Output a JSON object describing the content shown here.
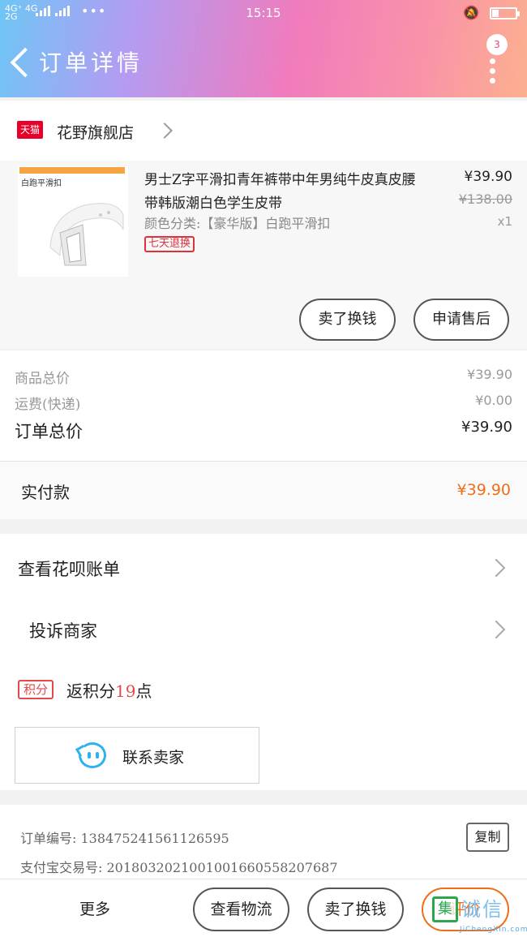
{
  "status_bar": {
    "network": "4G⁺ 4G\n2G",
    "signal2": "2G",
    "dots": "•••",
    "time": "15:15"
  },
  "header": {
    "title": "订单详情",
    "badge_count": "3"
  },
  "shop": {
    "logo_text": "天猫",
    "name": "花野旗舰店"
  },
  "product": {
    "thumb_tag": "白跑平滑扣",
    "title": "男士Z字平滑扣青年裤带中年男纯牛皮真皮腰带韩版潮白色学生皮带",
    "spec": "颜色分类:【豪华版】白跑平滑扣",
    "return_tag": "七天退换",
    "price": "¥39.90",
    "original_price": "¥138.00",
    "quantity": "x1",
    "btn_sell": "卖了换钱",
    "btn_aftersale": "申请售后"
  },
  "summary": {
    "goods_total_label": "商品总价",
    "goods_total_value": "¥39.90",
    "shipping_label": "运费(快递)",
    "shipping_value": "¥0.00",
    "order_total_label": "订单总价",
    "order_total_value": "¥39.90"
  },
  "paid": {
    "label": "实付款",
    "value": "¥39.90"
  },
  "actions": {
    "huabei": "查看花呗账单",
    "complain": "投诉商家",
    "points_chip": "积分",
    "points_prefix": "返积分",
    "points_num": "19",
    "points_suffix": "点",
    "contact": "联系卖家"
  },
  "order_info": {
    "order_no": "订单编号: 138475241561126595",
    "alipay_no": "支付宝交易号: 2018032021001001660558207687",
    "copy": "复制"
  },
  "bottom_bar": {
    "more": "更多",
    "logistics": "查看物流",
    "sell": "卖了换钱",
    "review": "评价"
  },
  "watermark": {
    "mark": "集",
    "title": "诚信",
    "sub": "JiChengXin.com"
  },
  "colors": {
    "accent_orange": "#f06d1a",
    "tmall_red": "#e8002a",
    "header_gradient": [
      "#6ec6f5",
      "#f07bbd",
      "#fcb08f"
    ]
  }
}
